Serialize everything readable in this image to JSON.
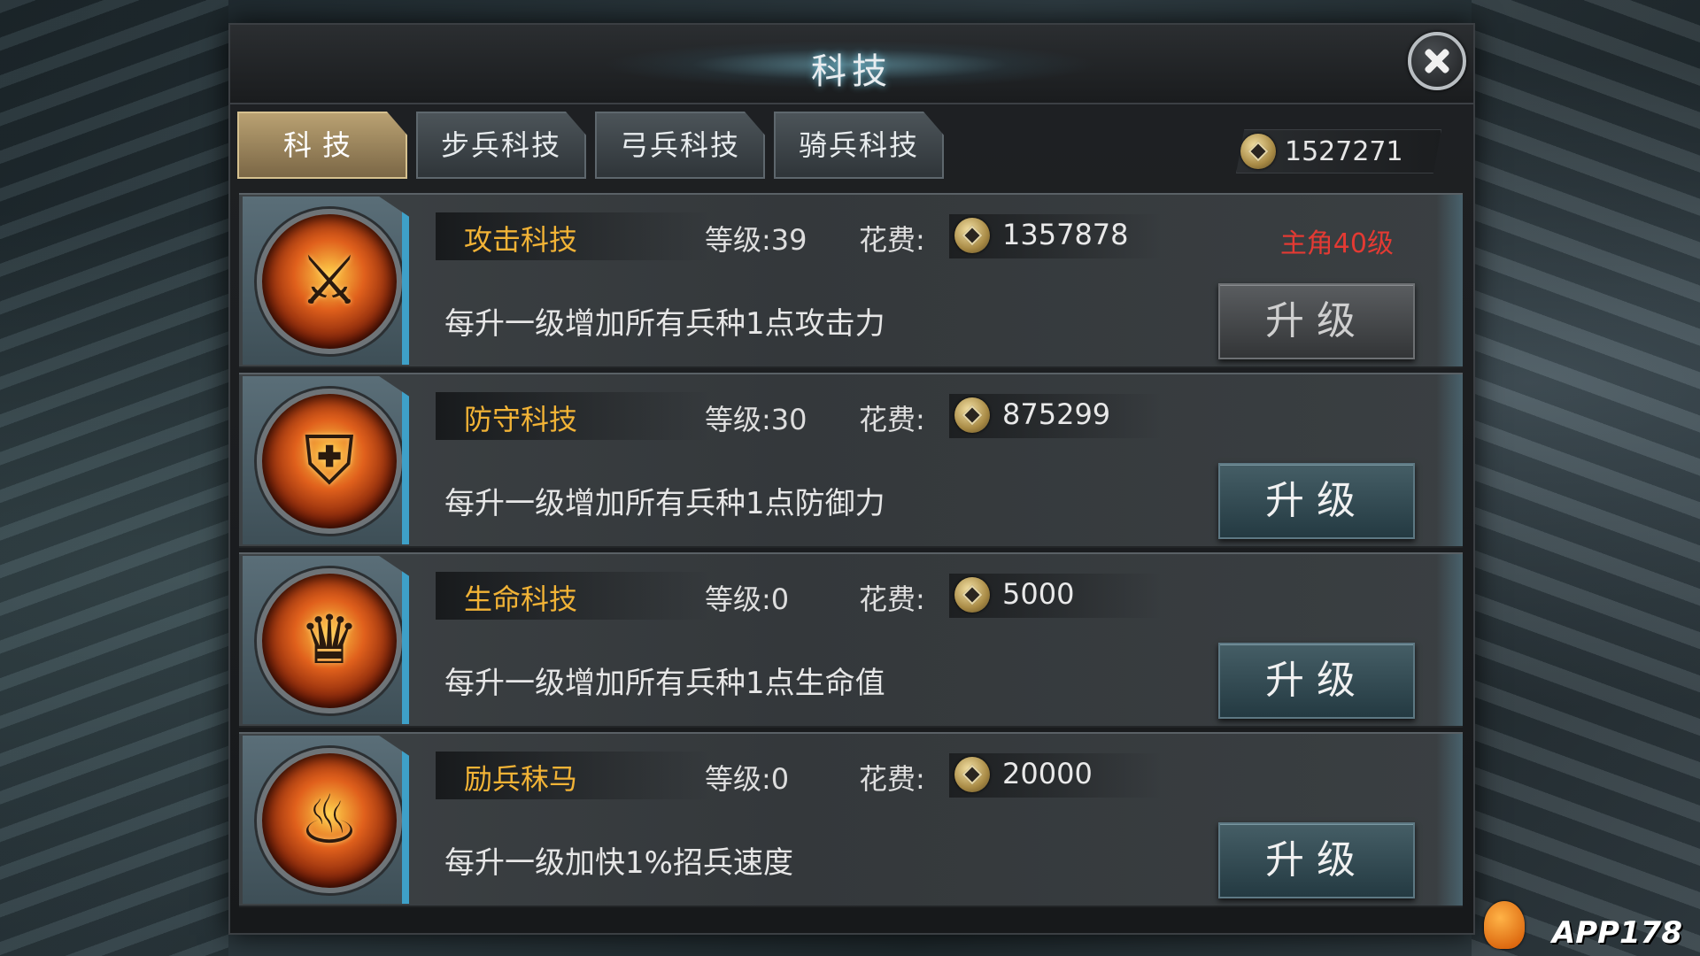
{
  "title": "科技",
  "tabs": [
    {
      "label": "科技",
      "active": true
    },
    {
      "label": "步兵科技",
      "active": false
    },
    {
      "label": "弓兵科技",
      "active": false
    },
    {
      "label": "骑兵科技",
      "active": false
    }
  ],
  "currency": {
    "icon": "coin-icon",
    "value": "1527271"
  },
  "cost_label": "花费:",
  "upgrade_label": "升级",
  "techs": [
    {
      "name": "攻击科技",
      "level": "等级:39",
      "cost": "1357878",
      "requirement": "主角40级",
      "desc": "每升一级增加所有兵种1点攻击力",
      "icon": "axe-icon",
      "glyph": "⚔",
      "upgrade_disabled": true
    },
    {
      "name": "防守科技",
      "level": "等级:30",
      "cost": "875299",
      "requirement": "",
      "desc": "每升一级增加所有兵种1点防御力",
      "icon": "armor-icon",
      "glyph": "⛨",
      "upgrade_disabled": false
    },
    {
      "name": "生命科技",
      "level": "等级:0",
      "cost": "5000",
      "requirement": "",
      "desc": "每升一级增加所有兵种1点生命值",
      "icon": "beast-armor-icon",
      "glyph": "♛",
      "upgrade_disabled": false
    },
    {
      "name": "励兵秣马",
      "level": "等级:0",
      "cost": "20000",
      "requirement": "",
      "desc": "每升一级加快1%招兵速度",
      "icon": "war-horn-icon",
      "glyph": "♨",
      "upgrade_disabled": false
    }
  ],
  "watermark": "APP178",
  "colors": {
    "name": "#f2b336",
    "requirement": "#e33a33",
    "active_tab": "#b9a172",
    "accent": "#3ea0c8"
  }
}
